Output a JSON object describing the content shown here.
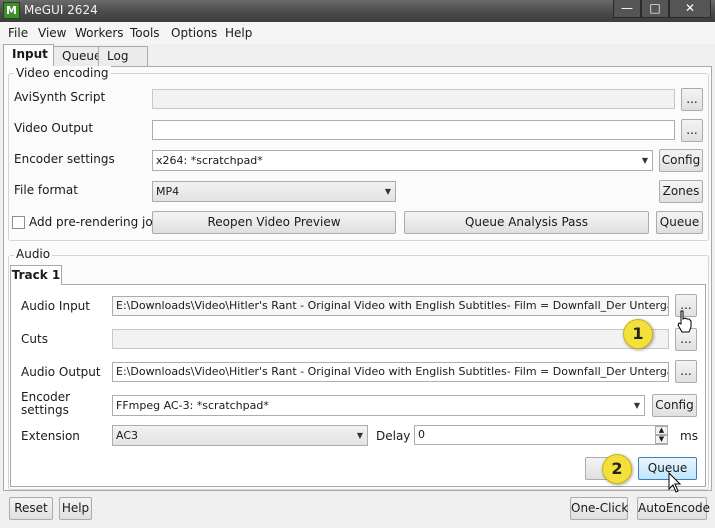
{
  "window": {
    "title": "MeGUI 2624",
    "icon_glyph": "M",
    "controls": {
      "minimize": "—",
      "maximize": "□",
      "close": "✕"
    }
  },
  "menu": [
    "File",
    "View",
    "Workers",
    "Tools",
    "Options",
    "Help"
  ],
  "tabs": [
    "Input",
    "Queue",
    "Log"
  ],
  "video": {
    "legend": "Video encoding",
    "avisynth_label": "AviSynth Script",
    "avisynth_value": "",
    "video_output_label": "Video Output",
    "video_output_value": "",
    "browse_label": "...",
    "encoder_label": "Encoder settings",
    "encoder_value": "x264: *scratchpad*",
    "config_label": "Config",
    "format_label": "File format",
    "format_value": "MP4",
    "zones_label": "Zones",
    "prerender_label": "Add pre-rendering job",
    "prerender_checked": false,
    "reopen_label": "Reopen Video Preview",
    "analysis_label": "Queue Analysis Pass",
    "queue_label": "Queue"
  },
  "audio": {
    "legend": "Audio",
    "track_tab": "Track 1",
    "input_label": "Audio Input",
    "input_value": "E:\\Downloads\\Video\\Hitler's Rant - Original Video with English Subtitles- Film = Downfall_Der Untergang - HD - YouTu",
    "cuts_label": "Cuts",
    "cuts_value": "",
    "output_label": "Audio Output",
    "output_value": "E:\\Downloads\\Video\\Hitler's Rant - Original Video with English Subtitles- Film = Downfall_Der Untergang - HD - YouTu",
    "encoder_label": "Encoder settings",
    "encoder_value": "FFmpeg AC-3: *scratchpad*",
    "config_label": "Config",
    "extension_label": "Extension",
    "extension_value": "AC3",
    "delay_label": "Delay",
    "delay_value": "0",
    "delay_unit": "ms",
    "queue_label": "Queue",
    "browse_label": "..."
  },
  "callouts": [
    "1",
    "2"
  ],
  "footer": {
    "reset": "Reset",
    "help": "Help",
    "one_click": "One-Click",
    "auto_encode": "AutoEncode"
  },
  "colors": {
    "callout": "#f3e03a",
    "titlebar": "#4b4b4b",
    "focus_button": "#bee6fd"
  }
}
